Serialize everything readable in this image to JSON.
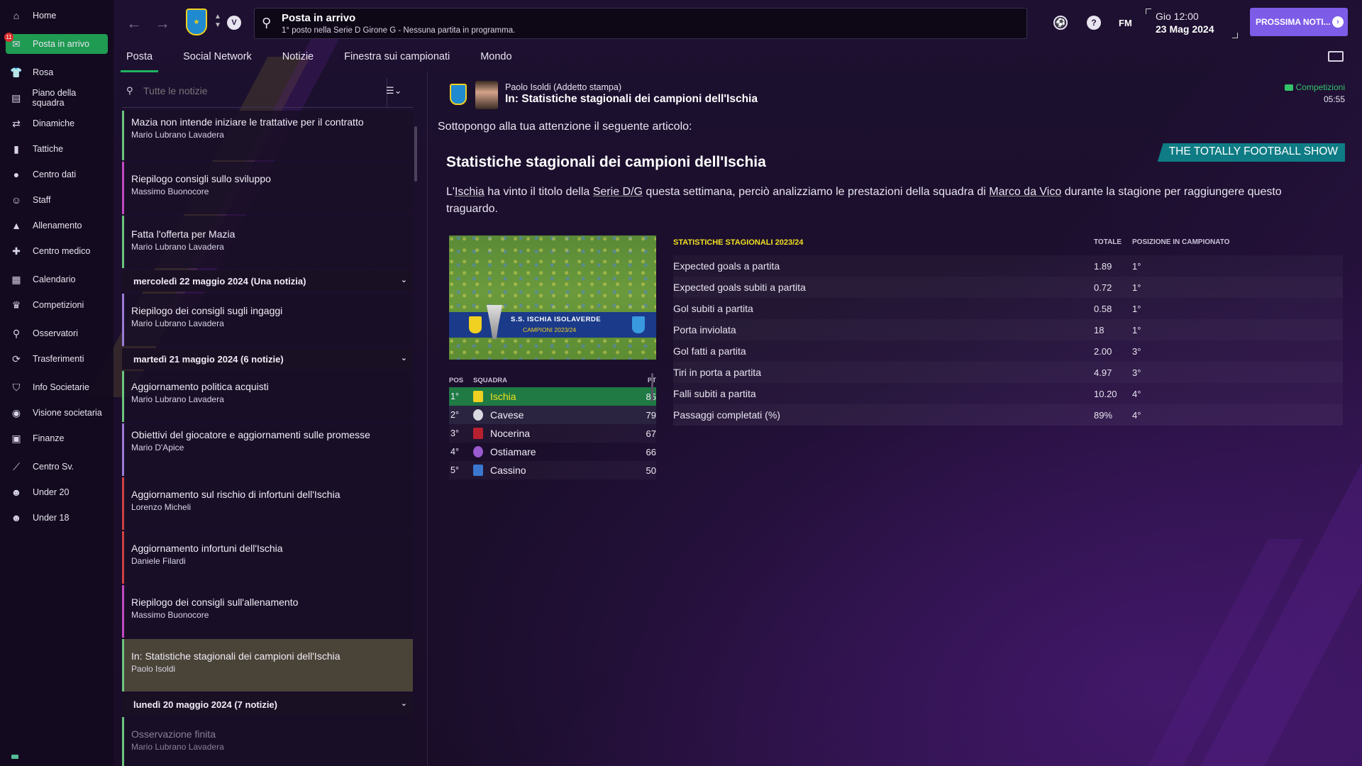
{
  "sidebar": {
    "items": [
      {
        "label": "Home",
        "icon": "home-icon"
      },
      {
        "label": "Posta in arrivo",
        "icon": "inbox-icon",
        "active": true,
        "badge": "11"
      },
      {
        "label": "Rosa",
        "icon": "squad-icon"
      },
      {
        "label": "Piano della squadra",
        "icon": "plan-icon"
      },
      {
        "label": "Dinamiche",
        "icon": "dynamics-icon"
      },
      {
        "label": "Tattiche",
        "icon": "tactics-icon"
      },
      {
        "label": "Centro dati",
        "icon": "data-icon"
      },
      {
        "label": "Staff",
        "icon": "staff-icon"
      },
      {
        "label": "Allenamento",
        "icon": "training-icon"
      },
      {
        "label": "Centro medico",
        "icon": "medical-icon"
      },
      {
        "label": "Calendario",
        "icon": "calendar-icon"
      },
      {
        "label": "Competizioni",
        "icon": "trophy-icon"
      },
      {
        "label": "Osservatori",
        "icon": "scouting-icon"
      },
      {
        "label": "Trasferimenti",
        "icon": "transfer-icon"
      },
      {
        "label": "Info Societarie",
        "icon": "club-info-icon"
      },
      {
        "label": "Visione societaria",
        "icon": "vision-icon"
      },
      {
        "label": "Finanze",
        "icon": "finance-icon"
      },
      {
        "label": "Centro Sv.",
        "icon": "development-icon"
      },
      {
        "label": "Under 20",
        "icon": "under20-icon"
      },
      {
        "label": "Under 18",
        "icon": "under18-icon"
      }
    ]
  },
  "topbar": {
    "title": "Posta in arrivo",
    "subtitle": "1° posto nella Serie D Girone G - Nessuna partita in programma.",
    "club_initial": "V",
    "fm": "FM",
    "day_time": "Gio 12:00",
    "date": "23 Mag 2024",
    "next_button": "PROSSIMA NOTI...",
    "help": "?"
  },
  "tabs": [
    "Posta",
    "Social Network",
    "Notizie",
    "Finestra sui campionati",
    "Mondo"
  ],
  "list": {
    "search_placeholder": "Tutte le notizie",
    "messages_top": [
      {
        "title": "Mazia non intende iniziare le trattative per il contratto",
        "sender": "Mario Lubrano Lavadera"
      },
      {
        "title": "Riepilogo consigli sullo sviluppo",
        "sender": "Massimo Buonocore"
      },
      {
        "title": "Fatta l'offerta per Mazia",
        "sender": "Mario Lubrano Lavadera"
      }
    ],
    "group1": "mercoledì 22 maggio 2024 (Una notizia)",
    "messages_g1": [
      {
        "title": "Riepilogo dei consigli sugli ingaggi",
        "sender": "Mario Lubrano Lavadera"
      }
    ],
    "group2": "martedì 21 maggio 2024 (6 notizie)",
    "messages_g2": [
      {
        "title": "Aggiornamento politica acquisti",
        "sender": "Mario Lubrano Lavadera"
      },
      {
        "title": "Obiettivi del giocatore e aggiornamenti sulle promesse",
        "sender": "Mario D'Apice"
      },
      {
        "title": "Aggiornamento sul rischio di infortuni dell'Ischia",
        "sender": "Lorenzo Micheli"
      },
      {
        "title": "Aggiornamento infortuni dell'Ischia",
        "sender": "Daniele Filardi"
      },
      {
        "title": "Riepilogo dei consigli sull'allenamento",
        "sender": "Massimo Buonocore"
      },
      {
        "title": "In: Statistiche stagionali dei campioni dell'Ischia",
        "sender": "Paolo Isoldi"
      }
    ],
    "group3": "lunedì 20 maggio 2024 (7 notizie)",
    "messages_g3": [
      {
        "title": "Osservazione finita",
        "sender": "Mario Lubrano Lavadera"
      }
    ]
  },
  "detail": {
    "sender": "Paolo Isoldi  (Addetto stampa)",
    "title": "In: Statistiche stagionali dei campioni dell'Ischia",
    "category": "Competizioni",
    "time": "05:55",
    "intro": "Sottopongo alla tua attenzione il seguente articolo:",
    "show": "THE TOTALLY FOOTBALL SHOW",
    "article_title": "Statistiche stagionali dei campioni dell'Ischia",
    "body_1": "L'",
    "body_link1": "Ischia",
    "body_2": " ha vinto il titolo della ",
    "body_link2": "Serie D/G",
    "body_3": " questa settimana, perciò analizziamo le prestazioni della squadra di ",
    "body_link3": "Marco da Vico",
    "body_4": " durante la stagione per raggiungere questo traguardo.",
    "banner_line1": "S.S. ISCHIA ISOLAVERDE",
    "banner_line2": "CAMPIONI 2023/24"
  },
  "league": {
    "headers": {
      "pos": "POS",
      "team": "SQUADRA",
      "pts": "PT"
    },
    "rows": [
      {
        "pos": "1°",
        "team": "Ischia",
        "pts": "85",
        "color": "#f0d020"
      },
      {
        "pos": "2°",
        "team": "Cavese",
        "pts": "79",
        "color": "#d8d8e0"
      },
      {
        "pos": "3°",
        "team": "Nocerina",
        "pts": "67",
        "color": "#b82030"
      },
      {
        "pos": "4°",
        "team": "Ostiamare",
        "pts": "66",
        "color": "#9b59d0"
      },
      {
        "pos": "5°",
        "team": "Cassino",
        "pts": "50",
        "color": "#3a78d0"
      }
    ]
  },
  "stats": {
    "title": "STATISTICHE STAGIONALI 2023/24",
    "col_total": "TOTALE",
    "col_pos": "POSIZIONE IN CAMPIONATO",
    "rows": [
      {
        "label": "Expected goals a partita",
        "value": "1.89",
        "pos": "1°"
      },
      {
        "label": "Expected goals subiti a partita",
        "value": "0.72",
        "pos": "1°"
      },
      {
        "label": "Gol subiti a partita",
        "value": "0.58",
        "pos": "1°"
      },
      {
        "label": "Porta inviolata",
        "value": "18",
        "pos": "1°"
      },
      {
        "label": "Gol fatti a partita",
        "value": "2.00",
        "pos": "3°"
      },
      {
        "label": "Tiri in porta a partita",
        "value": "4.97",
        "pos": "3°"
      },
      {
        "label": "Falli subiti a partita",
        "value": "10.20",
        "pos": "4°"
      },
      {
        "label": "Passaggi completati (%)",
        "value": "89%",
        "pos": "4°"
      }
    ]
  }
}
